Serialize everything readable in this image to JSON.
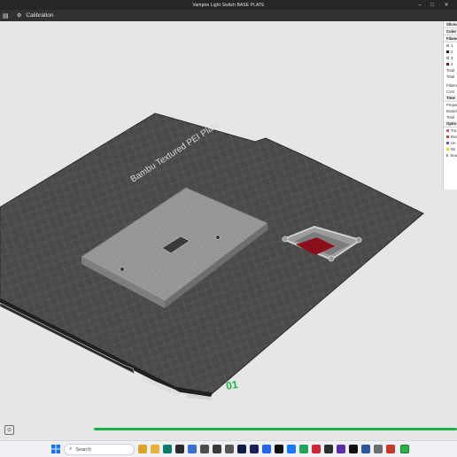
{
  "window": {
    "title": "Vampire Light Switch BASE PLATE"
  },
  "tabs": [
    {
      "label": "Calibration",
      "glyph": "⚙"
    }
  ],
  "plate": {
    "label": "Bambu Textured PEI Plate",
    "number": "01"
  },
  "panel": {
    "header_slicing": "Slicing",
    "header_color": "Color",
    "header_filament": "Filament",
    "filaments": [
      {
        "id": "1",
        "color": "#aaaaaa"
      },
      {
        "id": "2",
        "color": "#222222"
      },
      {
        "id": "3",
        "color": "#ffffff"
      },
      {
        "id": "4",
        "color": "#8b0f1a"
      }
    ],
    "total_1": "Total",
    "total_2": "Total",
    "filament_label": "Filame",
    "cost_label": "Cost",
    "header_time": "Time",
    "prepare_label": "Prepar",
    "model_label": "Model",
    "total_3": "Total",
    "header_options": "Optio",
    "options": [
      {
        "label": "Tra",
        "color": "#e84b8a"
      },
      {
        "label": "Ret",
        "color": "#c94e2d"
      },
      {
        "label": "Un",
        "color": "#7a4fd8"
      },
      {
        "label": "Wi",
        "color": "#f2d31b"
      },
      {
        "label": "Sea",
        "color": "#e9e9e9"
      }
    ]
  },
  "progress": {
    "value": 1.0
  },
  "taskbar": {
    "search_placeholder": "Search"
  }
}
